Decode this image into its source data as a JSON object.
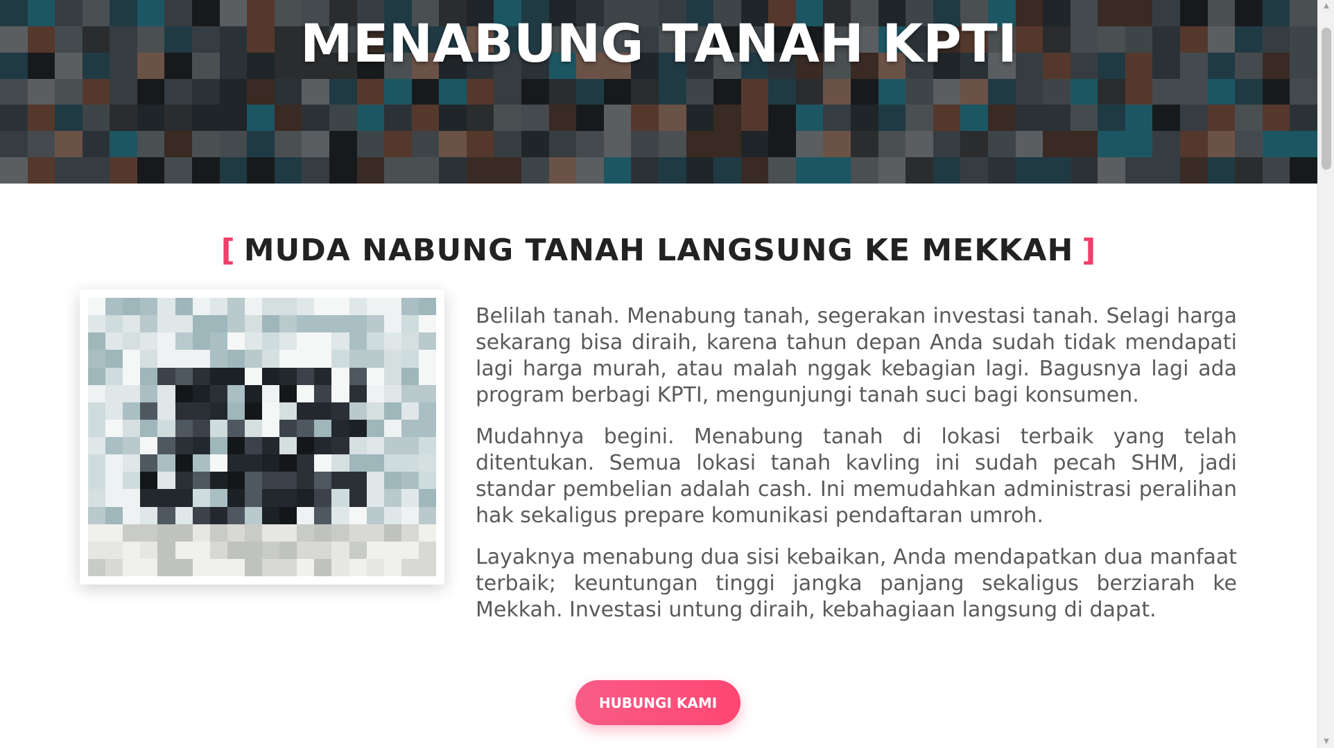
{
  "hero": {
    "title": "MENABUNG TANAH KPTI"
  },
  "section": {
    "bracket_open": "[",
    "heading": "MUDA NABUNG TANAH LANGSUNG KE MEKKAH",
    "bracket_close": "]",
    "paragraphs": [
      "Belilah tanah. Menabung tanah, segerakan investasi tanah. Selagi harga sekarang bisa diraih, karena tahun depan Anda sudah tidak mendapati lagi harga murah, atau malah nggak kebagian lagi. Bagusnya lagi ada program berbagi KPTI, mengunjungi tanah suci bagi konsumen.",
      "Mudahnya begini. Menabung tanah di lokasi terbaik yang telah ditentukan. Semua lokasi tanah kavling ini sudah pecah SHM, jadi standar pembelian adalah cash. Ini memudahkan administrasi peralihan hak sekaligus prepare komunikasi pendaftaran umroh.",
      "Layaknya menabung dua sisi kebaikan, Anda mendapatkan dua manfaat terbaik; keuntungan tinggi jangka panjang sekaligus berziarah ke Mekkah. Investasi untung diraih, kebahagiaan langsung di dapat."
    ]
  },
  "cta": {
    "label": "HUBUNGI KAMI"
  },
  "colors": {
    "accent": "#f0406a",
    "button": "#ff4f7b",
    "heading": "#222222",
    "body_text": "#5a5a5a"
  },
  "icons": {
    "scroll_up": "triangle-up-icon",
    "scroll_down": "triangle-down-icon"
  }
}
